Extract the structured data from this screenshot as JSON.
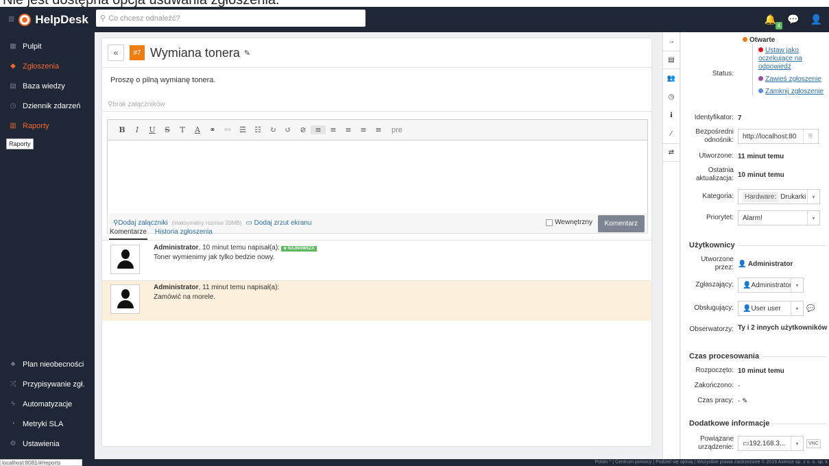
{
  "caption": "Nie jest dostępna opcja usuwania zgłoszenia.",
  "app": {
    "brand": "HelpDesk",
    "search_placeholder": "Co chcesz odnaleźć?",
    "notif_count": "4"
  },
  "sidebar": {
    "items": [
      {
        "label": "Pulpit",
        "icon": "dashboard-icon"
      },
      {
        "label": "Zgłoszenia",
        "icon": "ticket-icon"
      },
      {
        "label": "Baza wiedzy",
        "icon": "book-icon"
      },
      {
        "label": "Dziennik zdarzeń",
        "icon": "clock-icon"
      },
      {
        "label": "Raporty",
        "icon": "report-icon"
      }
    ],
    "tooltip": "Raporty",
    "bottom": [
      {
        "label": "Plan nieobecności"
      },
      {
        "label": "Przypisywanie zgł."
      },
      {
        "label": "Automatyzacje"
      },
      {
        "label": "Metryki SLA"
      },
      {
        "label": "Ustawienia"
      }
    ],
    "status_url": "localhost:8081/#/reports"
  },
  "ticket": {
    "number": "#7",
    "title": "Wymiana tonera",
    "description": "Proszę o pilną wymianę tonera.",
    "attachments": "brak załączników"
  },
  "composer": {
    "toolbar": [
      "B",
      "I",
      "U",
      "S",
      "T",
      "A",
      "⚭",
      "⚯",
      "☰",
      "☷",
      "↻",
      "↺",
      "⊘",
      "≡",
      "≡",
      "≡",
      "≡",
      "≡"
    ],
    "pre_label": "pre",
    "add_attachment": "Dodaj załączniki",
    "max_size": "(maksymalny rozmiar 20MB)",
    "add_screenshot": "Dodaj zrzut ekranu",
    "internal_label": "Wewnętrzny",
    "comment_button": "Komentarz"
  },
  "tabs": [
    {
      "label": "Komentarze"
    },
    {
      "label": "Historia zgłoszenia"
    }
  ],
  "comments": [
    {
      "author": "Administrator",
      "meta": ", 10 minut temu napisał(a):",
      "badge": "★ NAJNOWSZA",
      "text": "Toner wymienimy jak tylko bedzie nowy."
    },
    {
      "author": "Administrator",
      "meta": ", 11 minut temu napisał(a):",
      "badge": "",
      "text": "Zamówić na morele."
    }
  ],
  "details": {
    "status_label": "Status:",
    "status_current": "Otwarte",
    "status_options": [
      "Ustaw jako oczekujące na odpowiedź",
      "Zawieś zgłoszenie",
      "Zamknij zgłoszenie"
    ],
    "status_colors": {
      "current": "#f07d12",
      "waiting": "#d9141e",
      "suspend": "#9c4f9c",
      "close": "#5a8fd8"
    },
    "id_label": "Identyfikator:",
    "id_value": "7",
    "link_label": "Bezpośredni odnośnik:",
    "link_value": "http://localhost:80",
    "created_label": "Utworzone:",
    "created_value": "11 minut temu",
    "updated_label": "Ostatnia aktualizacja:",
    "updated_value": "10 minut temu",
    "category_label": "Kategoria:",
    "category_tag": "Hardware:",
    "category_value": "Drukarki",
    "priority_label": "Priorytet:",
    "priority_value": "Alarm!"
  },
  "users": {
    "title": "Użytkownicy",
    "created_by_label": "Utworzone przez:",
    "created_by": "Administrator",
    "reporter_label": "Zgłaszający:",
    "reporter": "Administrator",
    "handler_label": "Obsługujący:",
    "handler": "User user",
    "observers_label": "Obserwatorzy:",
    "observers": "Ty i 2 innych użytkowników"
  },
  "processing": {
    "title": "Czas procesowania",
    "started_label": "Rozpoczęto:",
    "started": "10 minut temu",
    "ended_label": "Zakończono:",
    "ended": "-",
    "work_label": "Czas pracy:",
    "work": "-"
  },
  "extra": {
    "title": "Dodatkowe informacje",
    "device_label": "Powiązane urządzenie:",
    "device": "192.168.3...",
    "vnc": "VNC"
  },
  "footer": "Polski ^ | Centrum pomocy | Podziel się opinią | Wszystkie prawa zastrzeżone © 2019 Axence sp. z o. o. sp. k"
}
